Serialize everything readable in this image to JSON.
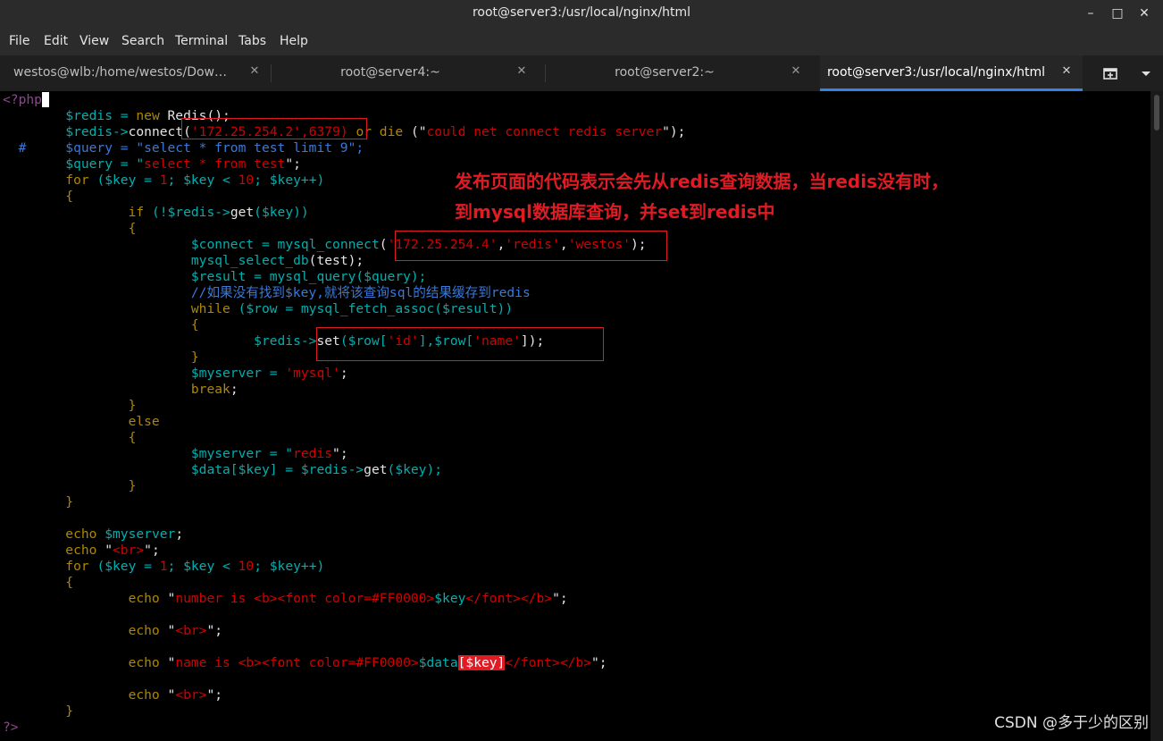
{
  "window": {
    "title": "root@server3:/usr/local/nginx/html"
  },
  "menu": [
    "File",
    "Edit",
    "View",
    "Search",
    "Terminal",
    "Tabs",
    "Help"
  ],
  "tabs": [
    {
      "label": "westos@wlb:/home/westos/Dow…",
      "active": false
    },
    {
      "label": "root@server4:~",
      "active": false
    },
    {
      "label": "root@server2:~",
      "active": false
    },
    {
      "label": "root@server3:/usr/local/nginx/html",
      "active": true
    }
  ],
  "code": {
    "open_tag": "<?php",
    "l1a": "        $redis = ",
    "l1b": "new",
    "l1c": " Redis();",
    "l2a": "        $redis->",
    "l2b": "connect",
    "l2c": "(",
    "l2d": "'172.25.254.2'",
    "l2e": ",6379) ",
    "l2f": "or die",
    "l2g": " (\"",
    "l2h": "could net connect redis server",
    "l2i": "\");",
    "l3a": "  #     $query = \"select * from test limit 9\";",
    "l4a": "        $query = \"",
    "l4b": "select * from test",
    "l4c": "\";",
    "l5a": "        for",
    "l5b": " ($key = ",
    "l5c": "1",
    "l5d": "; $key < ",
    "l5e": "10",
    "l5f": "; $key++)",
    "l6": "        {",
    "l7a": "                if",
    "l7b": " (!$redis->",
    "l7c": "get",
    "l7d": "($key))",
    "l8": "                {",
    "l9a": "                        $connect = ",
    "l9b": "mysql_connect",
    "l9c": "(",
    "l9d": "'172.25.254.4'",
    "l9e": ",",
    "l9f": "'redis'",
    "l9g": ",",
    "l9h": "'westos'",
    "l9i": ");",
    "l10a": "                        mysql_select_db",
    "l10b": "(",
    "l10c": "test",
    "l10d": ");",
    "l11a": "                        $result = ",
    "l11b": "mysql_query",
    "l11c": "($query);",
    "l12a": "                        //如果没有找到$key,就将该查询sql的结果缓存到redis",
    "l13a": "                        while",
    "l13b": " ($row = ",
    "l13c": "mysql_fetch_assoc",
    "l13d": "($result))",
    "l14": "                        {",
    "l15a": "                                $redis->",
    "l15b": "set",
    "l15c": "($row[",
    "l15d": "'id'",
    "l15e": "],$row[",
    "l15f": "'name'",
    "l15g": "]);",
    "l16": "                        }",
    "l17a": "                        $myserver = ",
    "l17b": "'mysql'",
    "l17c": ";",
    "l18a": "                        break",
    "l18b": ";",
    "l19": "                }",
    "l20": "                else",
    "l21": "                {",
    "l22a": "                        $myserver = \"",
    "l22b": "redis",
    "l22c": "\";",
    "l23a": "                        $data[$key] = $redis->",
    "l23b": "get",
    "l23c": "($key);",
    "l24": "                }",
    "l25": "        }",
    "l26a": "        echo",
    "l26b": " $myserver",
    "l26c": ";",
    "l27a": "        echo",
    "l27b": " \"",
    "l27c": "<br>",
    "l27d": "\";",
    "l28a": "        for",
    "l28b": " ($key = ",
    "l28c": "1",
    "l28d": "; $key < ",
    "l28e": "10",
    "l28f": "; $key++)",
    "l29": "        {",
    "l30a": "                echo",
    "l30b": " \"",
    "l30c": "number is <b><font color=#FF0000>",
    "l30d": "$key",
    "l30e": "</font></b>",
    "l30f": "\";",
    "l31a": "                echo",
    "l31b": " \"",
    "l31c": "<br>",
    "l31d": "\";",
    "l32a": "                echo",
    "l32b": " \"",
    "l32c": "name is <b><font color=#FF0000>",
    "l32d": "$data",
    "l32e": "[$key]",
    "l32f": "</font></b>",
    "l32g": "\";",
    "l33a": "                echo",
    "l33b": " \"",
    "l33c": "<br>",
    "l33d": "\";",
    "l34": "        }",
    "close_tag": "?>"
  },
  "annotation": {
    "line1": "发布页面的代码表示会先从redis查询数据，当redis没有时，",
    "line2": "到mysql数据库查询，并set到redis中"
  },
  "watermark": "CSDN @多于少的区别",
  "colors": {
    "keyword": "#af8700",
    "variable": "#00afaf",
    "string": "#d30000",
    "comment": "#3a79d8",
    "annotation": "#e01b24",
    "tab_active_indicator": "#3584e4"
  }
}
